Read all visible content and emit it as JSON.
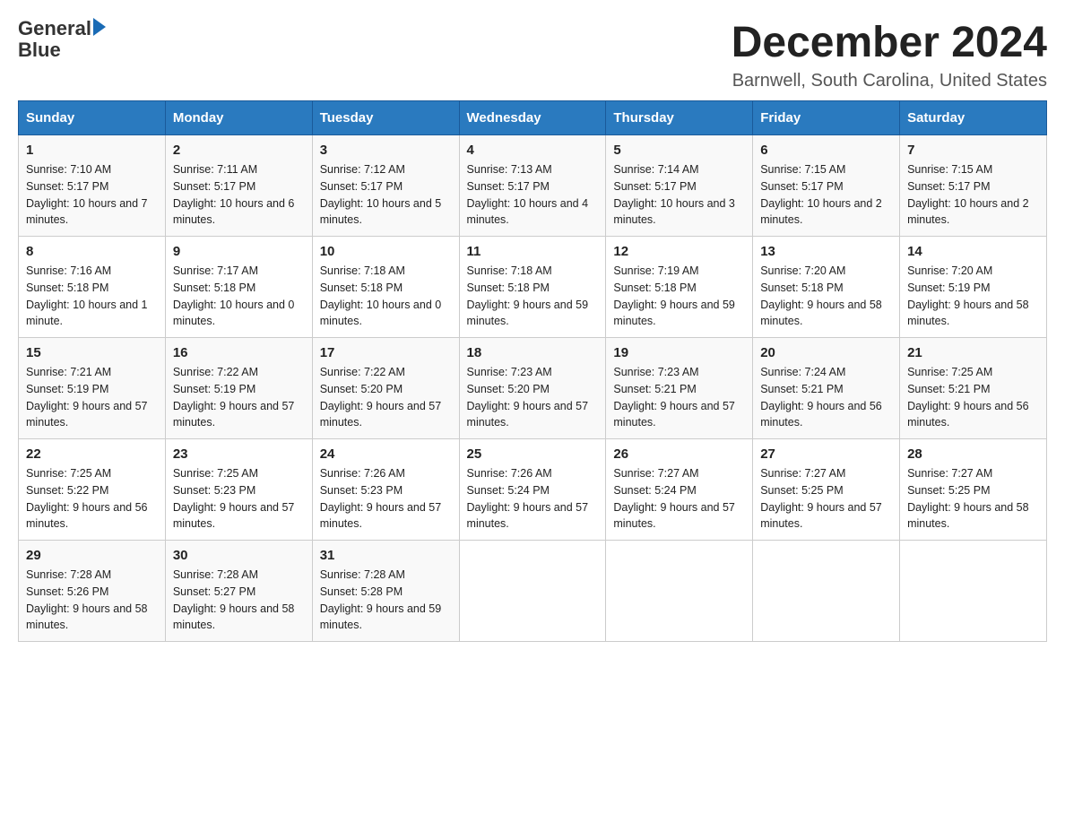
{
  "header": {
    "logo_general": "General",
    "logo_blue": "Blue",
    "month_title": "December 2024",
    "subtitle": "Barnwell, South Carolina, United States"
  },
  "days_of_week": [
    "Sunday",
    "Monday",
    "Tuesday",
    "Wednesday",
    "Thursday",
    "Friday",
    "Saturday"
  ],
  "weeks": [
    [
      {
        "day": "1",
        "sunrise": "7:10 AM",
        "sunset": "5:17 PM",
        "daylight": "10 hours and 7 minutes."
      },
      {
        "day": "2",
        "sunrise": "7:11 AM",
        "sunset": "5:17 PM",
        "daylight": "10 hours and 6 minutes."
      },
      {
        "day": "3",
        "sunrise": "7:12 AM",
        "sunset": "5:17 PM",
        "daylight": "10 hours and 5 minutes."
      },
      {
        "day": "4",
        "sunrise": "7:13 AM",
        "sunset": "5:17 PM",
        "daylight": "10 hours and 4 minutes."
      },
      {
        "day": "5",
        "sunrise": "7:14 AM",
        "sunset": "5:17 PM",
        "daylight": "10 hours and 3 minutes."
      },
      {
        "day": "6",
        "sunrise": "7:15 AM",
        "sunset": "5:17 PM",
        "daylight": "10 hours and 2 minutes."
      },
      {
        "day": "7",
        "sunrise": "7:15 AM",
        "sunset": "5:17 PM",
        "daylight": "10 hours and 2 minutes."
      }
    ],
    [
      {
        "day": "8",
        "sunrise": "7:16 AM",
        "sunset": "5:18 PM",
        "daylight": "10 hours and 1 minute."
      },
      {
        "day": "9",
        "sunrise": "7:17 AM",
        "sunset": "5:18 PM",
        "daylight": "10 hours and 0 minutes."
      },
      {
        "day": "10",
        "sunrise": "7:18 AM",
        "sunset": "5:18 PM",
        "daylight": "10 hours and 0 minutes."
      },
      {
        "day": "11",
        "sunrise": "7:18 AM",
        "sunset": "5:18 PM",
        "daylight": "9 hours and 59 minutes."
      },
      {
        "day": "12",
        "sunrise": "7:19 AM",
        "sunset": "5:18 PM",
        "daylight": "9 hours and 59 minutes."
      },
      {
        "day": "13",
        "sunrise": "7:20 AM",
        "sunset": "5:18 PM",
        "daylight": "9 hours and 58 minutes."
      },
      {
        "day": "14",
        "sunrise": "7:20 AM",
        "sunset": "5:19 PM",
        "daylight": "9 hours and 58 minutes."
      }
    ],
    [
      {
        "day": "15",
        "sunrise": "7:21 AM",
        "sunset": "5:19 PM",
        "daylight": "9 hours and 57 minutes."
      },
      {
        "day": "16",
        "sunrise": "7:22 AM",
        "sunset": "5:19 PM",
        "daylight": "9 hours and 57 minutes."
      },
      {
        "day": "17",
        "sunrise": "7:22 AM",
        "sunset": "5:20 PM",
        "daylight": "9 hours and 57 minutes."
      },
      {
        "day": "18",
        "sunrise": "7:23 AM",
        "sunset": "5:20 PM",
        "daylight": "9 hours and 57 minutes."
      },
      {
        "day": "19",
        "sunrise": "7:23 AM",
        "sunset": "5:21 PM",
        "daylight": "9 hours and 57 minutes."
      },
      {
        "day": "20",
        "sunrise": "7:24 AM",
        "sunset": "5:21 PM",
        "daylight": "9 hours and 56 minutes."
      },
      {
        "day": "21",
        "sunrise": "7:25 AM",
        "sunset": "5:21 PM",
        "daylight": "9 hours and 56 minutes."
      }
    ],
    [
      {
        "day": "22",
        "sunrise": "7:25 AM",
        "sunset": "5:22 PM",
        "daylight": "9 hours and 56 minutes."
      },
      {
        "day": "23",
        "sunrise": "7:25 AM",
        "sunset": "5:23 PM",
        "daylight": "9 hours and 57 minutes."
      },
      {
        "day": "24",
        "sunrise": "7:26 AM",
        "sunset": "5:23 PM",
        "daylight": "9 hours and 57 minutes."
      },
      {
        "day": "25",
        "sunrise": "7:26 AM",
        "sunset": "5:24 PM",
        "daylight": "9 hours and 57 minutes."
      },
      {
        "day": "26",
        "sunrise": "7:27 AM",
        "sunset": "5:24 PM",
        "daylight": "9 hours and 57 minutes."
      },
      {
        "day": "27",
        "sunrise": "7:27 AM",
        "sunset": "5:25 PM",
        "daylight": "9 hours and 57 minutes."
      },
      {
        "day": "28",
        "sunrise": "7:27 AM",
        "sunset": "5:25 PM",
        "daylight": "9 hours and 58 minutes."
      }
    ],
    [
      {
        "day": "29",
        "sunrise": "7:28 AM",
        "sunset": "5:26 PM",
        "daylight": "9 hours and 58 minutes."
      },
      {
        "day": "30",
        "sunrise": "7:28 AM",
        "sunset": "5:27 PM",
        "daylight": "9 hours and 58 minutes."
      },
      {
        "day": "31",
        "sunrise": "7:28 AM",
        "sunset": "5:28 PM",
        "daylight": "9 hours and 59 minutes."
      },
      null,
      null,
      null,
      null
    ]
  ]
}
